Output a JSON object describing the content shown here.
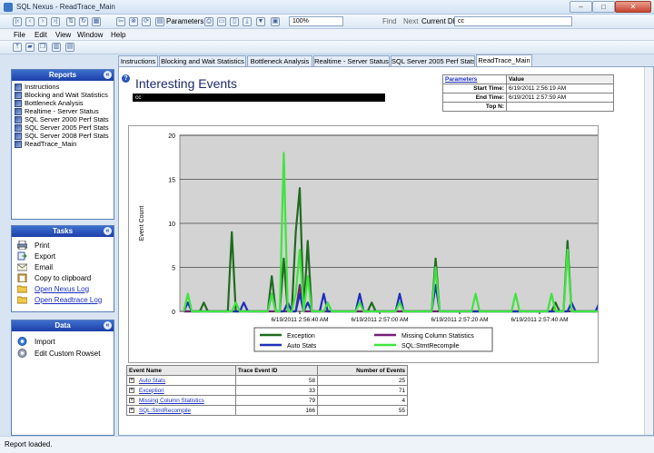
{
  "window": {
    "title": "SQL Nexus - ReadTrace_Main"
  },
  "toolbar": {
    "parameters_label": "Parameters",
    "zoom_value": "100%",
    "find_label": "Find",
    "next_label": "Next",
    "current_db_label": "Current DB",
    "current_db_value": "cc"
  },
  "menu": [
    "File",
    "Edit",
    "View",
    "Window",
    "Help"
  ],
  "reports_panel": {
    "title": "Reports",
    "items": [
      "Instructions",
      "Blocking and Wait Statistics",
      "Bottleneck Analysis",
      "Realtime - Server Status",
      "SQL Server 2000 Perf Stats",
      "SQL Server 2005 Perf Stats",
      "SQL Server 2008 Perf Stats",
      "ReadTrace_Main"
    ]
  },
  "tasks_panel": {
    "title": "Tasks",
    "items": [
      "Print",
      "Export",
      "Email",
      "Copy to clipboard",
      "Open Nexus Log",
      "Open Readtrace Log"
    ]
  },
  "data_panel": {
    "title": "Data",
    "items": [
      "Import",
      "Edit Custom Rowset"
    ]
  },
  "tabs": [
    "Instructions",
    "Blocking and Wait Statistics",
    "Bottleneck Analysis",
    "Realtime - Server Status",
    "SQL Server 2005 Perf Stats",
    "ReadTrace_Main"
  ],
  "report": {
    "title": "Interesting Events",
    "db_bar": "cc",
    "parameters": {
      "header_link": "Parameters",
      "header_value": "Value",
      "rows": [
        {
          "label": "Start Time:",
          "value": "6/19/2011 2:56:19 AM"
        },
        {
          "label": "End Time:",
          "value": "6/19/2011 2:57:59 AM"
        },
        {
          "label": "Top N:",
          "value": ""
        }
      ]
    },
    "events_table": {
      "headers": [
        "Event Name",
        "Trace Event ID",
        "Number of Events"
      ],
      "rows": [
        {
          "name": "Auto Stats",
          "id": "58",
          "count": "25"
        },
        {
          "name": "Exception",
          "id": "33",
          "count": "71"
        },
        {
          "name": "Missing Column Statistics",
          "id": "79",
          "count": "4"
        },
        {
          "name": "SQL:StmtRecompile",
          "id": "166",
          "count": "55"
        }
      ]
    }
  },
  "status": {
    "text": "Report loaded."
  },
  "chart_data": {
    "type": "line",
    "ylabel": "Event Count",
    "ylim": [
      0,
      20
    ],
    "yticks": [
      0,
      5,
      10,
      15,
      20
    ],
    "x_tick_labels": [
      "6/19/2011 2:56:40 AM",
      "6/19/2011 2:57:00 AM",
      "6/19/2011 2:57:20 AM",
      "6/19/2011 2:57:40 AM"
    ],
    "x_tick_positions_s": [
      20,
      40,
      60,
      80
    ],
    "x_range_s": [
      -10,
      95
    ],
    "grid": true,
    "legend_position": "bottom",
    "series": [
      {
        "name": "Exception",
        "color": "#1f6b1f",
        "points": [
          [
            -9,
            0
          ],
          [
            -5,
            0
          ],
          [
            -4,
            1
          ],
          [
            -3,
            0
          ],
          [
            1,
            0
          ],
          [
            2,
            0
          ],
          [
            3,
            9
          ],
          [
            4,
            0
          ],
          [
            5,
            0
          ],
          [
            12,
            0
          ],
          [
            13,
            4
          ],
          [
            14,
            0
          ],
          [
            15,
            0
          ],
          [
            16,
            6
          ],
          [
            17,
            0
          ],
          [
            18,
            0
          ],
          [
            19,
            9
          ],
          [
            20,
            14
          ],
          [
            21,
            0
          ],
          [
            22,
            8
          ],
          [
            23,
            0
          ],
          [
            37,
            0
          ],
          [
            38,
            1
          ],
          [
            39,
            0
          ],
          [
            53,
            0
          ],
          [
            54,
            6
          ],
          [
            55,
            0
          ],
          [
            83,
            0
          ],
          [
            84,
            1
          ],
          [
            85,
            0
          ],
          [
            86,
            0
          ],
          [
            87,
            8
          ],
          [
            88,
            0
          ],
          [
            95,
            0
          ]
        ]
      },
      {
        "name": "Missing Column Statistics",
        "color": "#7a1f7a",
        "points": [
          [
            -9,
            0
          ],
          [
            19,
            0
          ],
          [
            20,
            3
          ],
          [
            21,
            0
          ],
          [
            95,
            0
          ]
        ]
      },
      {
        "name": "Auto Stats",
        "color": "#1f2fb8",
        "points": [
          [
            -9,
            0
          ],
          [
            -8,
            1
          ],
          [
            -7,
            0
          ],
          [
            5,
            0
          ],
          [
            6,
            1
          ],
          [
            7,
            0
          ],
          [
            12,
            0
          ],
          [
            13,
            2
          ],
          [
            14,
            0
          ],
          [
            16,
            0
          ],
          [
            17,
            1
          ],
          [
            18,
            0
          ],
          [
            19,
            0
          ],
          [
            20,
            2
          ],
          [
            21,
            0
          ],
          [
            22,
            1
          ],
          [
            23,
            0
          ],
          [
            25,
            0
          ],
          [
            26,
            2
          ],
          [
            27,
            0
          ],
          [
            34,
            0
          ],
          [
            35,
            2
          ],
          [
            36,
            0
          ],
          [
            44,
            0
          ],
          [
            45,
            2
          ],
          [
            46,
            0
          ],
          [
            53,
            0
          ],
          [
            54,
            3
          ],
          [
            55,
            0
          ],
          [
            87,
            0
          ],
          [
            88,
            1
          ],
          [
            89,
            0
          ],
          [
            94,
            0
          ],
          [
            95,
            1
          ]
        ]
      },
      {
        "name": "SQL:StmtRecompile",
        "color": "#3ee43e",
        "points": [
          [
            -9,
            0
          ],
          [
            -8,
            2
          ],
          [
            -7,
            0
          ],
          [
            3,
            0
          ],
          [
            4,
            1
          ],
          [
            5,
            0
          ],
          [
            12,
            0
          ],
          [
            13,
            2
          ],
          [
            14,
            0
          ],
          [
            15,
            0
          ],
          [
            16,
            18
          ],
          [
            17,
            0
          ],
          [
            18,
            0
          ],
          [
            19,
            2
          ],
          [
            20,
            7
          ],
          [
            21,
            0
          ],
          [
            22,
            4
          ],
          [
            23,
            0
          ],
          [
            26,
            0
          ],
          [
            27,
            1
          ],
          [
            28,
            0
          ],
          [
            34,
            0
          ],
          [
            35,
            1
          ],
          [
            36,
            0
          ],
          [
            44,
            0
          ],
          [
            45,
            1
          ],
          [
            46,
            0
          ],
          [
            53,
            0
          ],
          [
            54,
            5
          ],
          [
            55,
            0
          ],
          [
            63,
            0
          ],
          [
            64,
            2
          ],
          [
            65,
            0
          ],
          [
            73,
            0
          ],
          [
            74,
            2
          ],
          [
            75,
            0
          ],
          [
            82,
            0
          ],
          [
            83,
            2
          ],
          [
            84,
            0
          ],
          [
            86,
            0
          ],
          [
            87,
            7
          ],
          [
            88,
            0
          ],
          [
            95,
            0
          ]
        ]
      }
    ]
  }
}
